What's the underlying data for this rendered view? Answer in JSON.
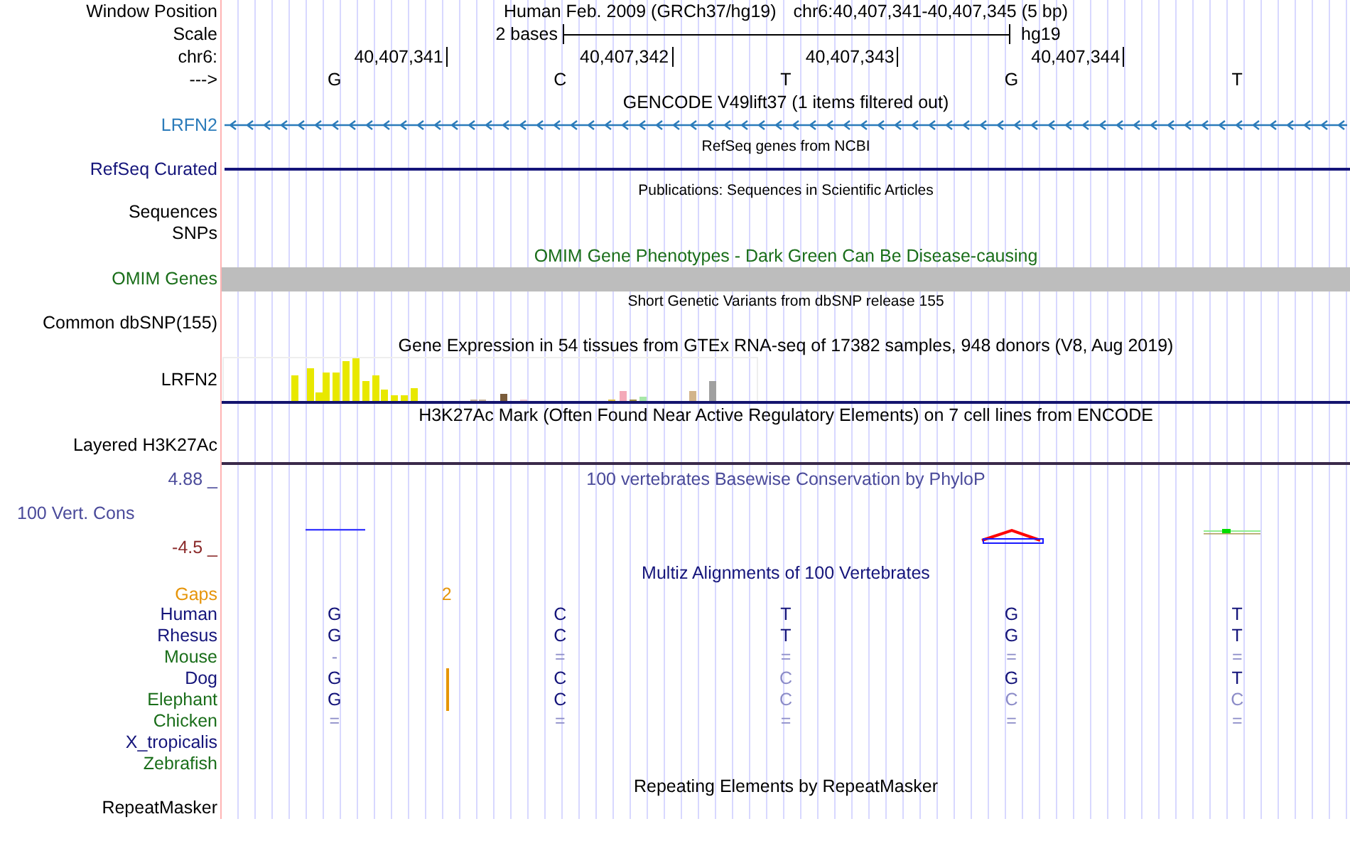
{
  "tracks": [
    {
      "kind": "position",
      "label": "Window Position",
      "color": "#000000",
      "assembly": "Human Feb. 2009 (GRCh37/hg19)",
      "range": "chr6:40,407,341-40,407,345 (5 bp)"
    },
    {
      "kind": "scale",
      "label": "Scale",
      "color": "#000000",
      "span": "2 bases",
      "genome": "hg19"
    },
    {
      "kind": "ruler",
      "label": "chr6:",
      "color": "#000000",
      "ticks": [
        "40,407,341",
        "40,407,342",
        "40,407,343",
        "40,407,344"
      ]
    },
    {
      "kind": "bases",
      "label": "--->",
      "color": "#000000",
      "bases": [
        "G",
        "C",
        "T",
        "G",
        "T"
      ]
    },
    {
      "kind": "title",
      "text": "GENCODE V49lift37 (1 items filtered out)",
      "color": "#000000"
    },
    {
      "kind": "gene",
      "label": "LRFN2",
      "color": "#2b7bba"
    },
    {
      "kind": "note",
      "text": "RefSeq genes from NCBI",
      "color": "#000000"
    },
    {
      "kind": "line",
      "label": "RefSeq Curated",
      "color": "#14147a"
    },
    {
      "kind": "note",
      "text": "Publications: Sequences in Scientific Articles",
      "color": "#000000"
    },
    {
      "kind": "empty",
      "label": "Sequences",
      "color": "#000000"
    },
    {
      "kind": "empty",
      "label": "SNPs",
      "color": "#000000"
    },
    {
      "kind": "title",
      "text": "OMIM Gene Phenotypes - Dark Green Can Be Disease-causing",
      "color": "#1a6e1a"
    },
    {
      "kind": "bar",
      "label": "OMIM Genes",
      "color": "#1a6e1a"
    },
    {
      "kind": "note",
      "text": "Short Genetic Variants from dbSNP release 155",
      "color": "#000000"
    },
    {
      "kind": "empty",
      "label": "Common dbSNP(155)",
      "color": "#000000"
    },
    {
      "kind": "title",
      "text": "Gene Expression in 54 tissues from GTEx RNA-seq of 17382 samples, 948 donors (V8, Aug 2019)",
      "color": "#000000"
    },
    {
      "kind": "expression",
      "label": "LRFN2",
      "color": "#000000"
    },
    {
      "kind": "title",
      "text": "H3K27Ac Mark (Often Found Near Active Regulatory Elements) on 7 cell lines from ENCODE",
      "color": "#000000"
    },
    {
      "kind": "signal",
      "label": "Layered H3K27Ac",
      "color": "#000000"
    },
    {
      "kind": "conservation",
      "label": "100 Vert. Cons",
      "color": "#4a4a9a",
      "max": "4.88 _",
      "min": "-4.5 _",
      "title": "100 vertebrates Basewise Conservation by PhyloP"
    },
    {
      "kind": "title",
      "text": "Multiz Alignments of 100 Vertebrates",
      "color": "#14147a"
    },
    {
      "kind": "gaps",
      "label": "Gaps",
      "color": "#e6950a",
      "marks": [
        {
          "text": "2"
        }
      ]
    },
    {
      "kind": "species",
      "label": "Human",
      "color": "#14147a",
      "insertion": false,
      "bases": [
        {
          "text": "G",
          "kind": "match"
        },
        {
          "text": "C",
          "kind": "match"
        },
        {
          "text": "T",
          "kind": "match"
        },
        {
          "text": "G",
          "kind": "match"
        },
        {
          "text": "T",
          "kind": "match"
        }
      ]
    },
    {
      "kind": "species",
      "label": "Rhesus",
      "color": "#14147a",
      "insertion": false,
      "bases": [
        {
          "text": "G",
          "kind": "match"
        },
        {
          "text": "C",
          "kind": "match"
        },
        {
          "text": "T",
          "kind": "match"
        },
        {
          "text": "G",
          "kind": "match"
        },
        {
          "text": "T",
          "kind": "match"
        }
      ]
    },
    {
      "kind": "species",
      "label": "Mouse",
      "color": "#1a6e1a",
      "insertion": false,
      "bases": [
        {
          "text": "-",
          "kind": "differ"
        },
        {
          "text": "=",
          "kind": "differ"
        },
        {
          "text": "=",
          "kind": "differ"
        },
        {
          "text": "=",
          "kind": "differ"
        },
        {
          "text": "=",
          "kind": "differ"
        }
      ]
    },
    {
      "kind": "species",
      "label": "Dog",
      "color": "#14147a",
      "insertion": true,
      "bases": [
        {
          "text": "G",
          "kind": "match"
        },
        {
          "text": "C",
          "kind": "match"
        },
        {
          "text": "C",
          "kind": "differ"
        },
        {
          "text": "G",
          "kind": "match"
        },
        {
          "text": "T",
          "kind": "match"
        }
      ]
    },
    {
      "kind": "species",
      "label": "Elephant",
      "color": "#1a6e1a",
      "insertion": true,
      "bases": [
        {
          "text": "G",
          "kind": "match"
        },
        {
          "text": "C",
          "kind": "match"
        },
        {
          "text": "C",
          "kind": "differ"
        },
        {
          "text": "C",
          "kind": "differ"
        },
        {
          "text": "C",
          "kind": "differ"
        }
      ]
    },
    {
      "kind": "species",
      "label": "Chicken",
      "color": "#1a6e1a",
      "insertion": false,
      "bases": [
        {
          "text": "=",
          "kind": "differ"
        },
        {
          "text": "=",
          "kind": "differ"
        },
        {
          "text": "=",
          "kind": "differ"
        },
        {
          "text": "=",
          "kind": "differ"
        },
        {
          "text": "=",
          "kind": "differ"
        }
      ]
    },
    {
      "kind": "species",
      "label": "X_tropicalis",
      "color": "#14147a",
      "insertion": false
    },
    {
      "kind": "species",
      "label": "Zebrafish",
      "color": "#1a6e1a",
      "insertion": false
    },
    {
      "kind": "title",
      "text": "Repeating Elements by RepeatMasker",
      "color": "#000000"
    },
    {
      "kind": "empty",
      "label": "RepeatMasker",
      "color": "#000000"
    }
  ]
}
